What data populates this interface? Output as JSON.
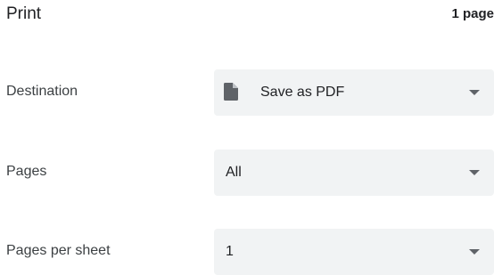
{
  "header": {
    "title": "Print",
    "page_count": "1 page"
  },
  "destination": {
    "label": "Destination",
    "value": "Save as PDF",
    "icon": "document-icon"
  },
  "pages": {
    "label": "Pages",
    "value": "All"
  },
  "pages_per_sheet": {
    "label": "Pages per sheet",
    "value": "1"
  },
  "colors": {
    "select_background": "#f1f3f4",
    "caret": "#5f6368",
    "icon": "#5f6368"
  }
}
